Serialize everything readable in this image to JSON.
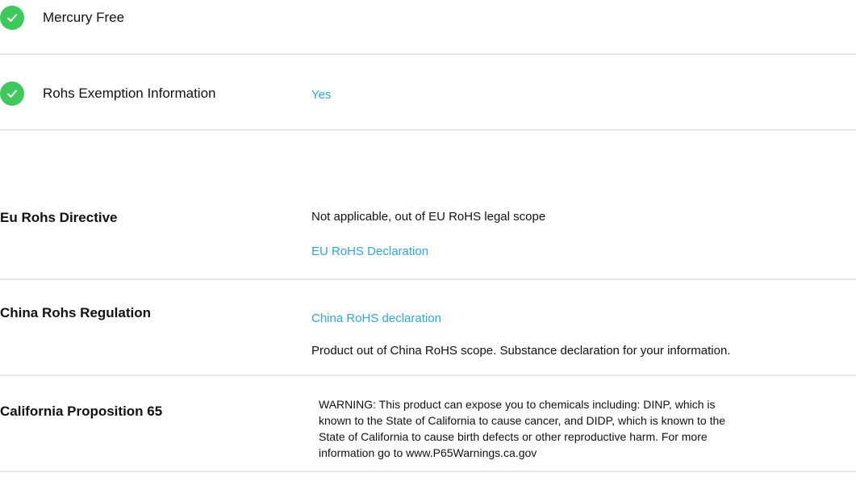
{
  "attributes": [
    {
      "label": "Mercury Free",
      "value": ""
    },
    {
      "label": "Rohs Exemption Information",
      "value": "Yes"
    }
  ],
  "compliance": {
    "eu": {
      "heading": "Eu Rohs Directive",
      "status": "Not applicable, out of EU RoHS legal scope",
      "link": "EU RoHS Declaration"
    },
    "china": {
      "heading": "China Rohs Regulation",
      "link": "China RoHS declaration",
      "note": "Product out of China RoHS scope. Substance declaration for your information."
    },
    "california": {
      "heading": "California Proposition 65",
      "warning_lines": [
        "WARNING: This product can expose you to chemicals including: DINP, which is",
        "known to the State of California to cause cancer, and DIDP, which is known to the",
        "State of California to cause birth defects or other reproductive harm. For more",
        "information go to www.P65Warnings.ca.gov"
      ]
    }
  },
  "colors": {
    "check": "#3ec95c",
    "link": "#2ba6de",
    "divider": "#e6e6e6"
  },
  "icons": {
    "status": "check-circle-icon"
  }
}
